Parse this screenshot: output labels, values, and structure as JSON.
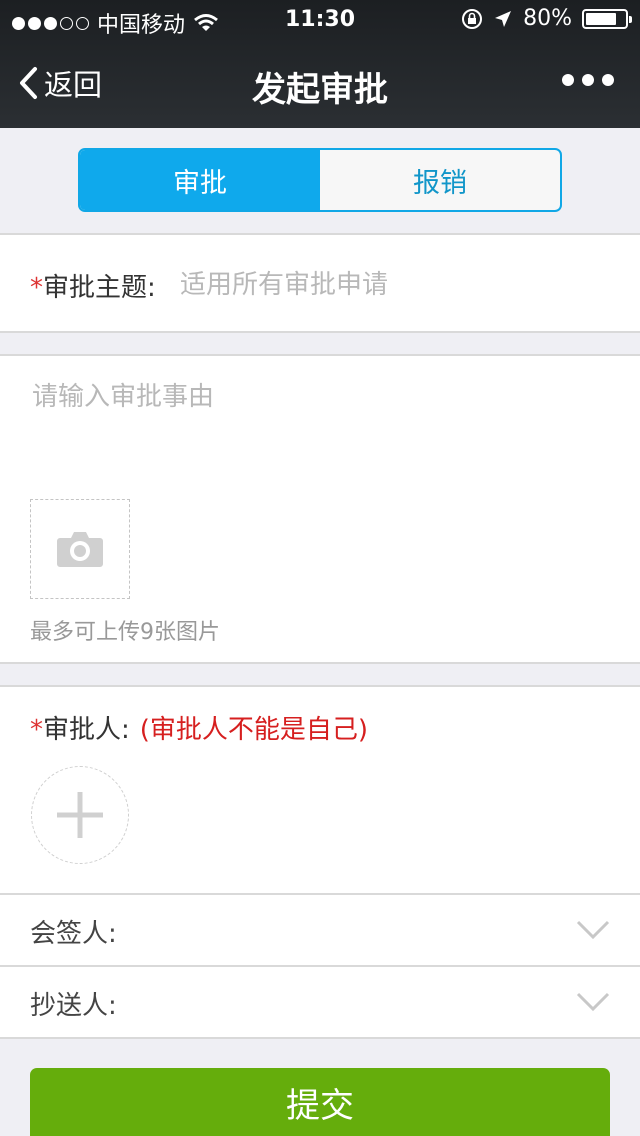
{
  "status_bar": {
    "signal_strength": 3,
    "carrier": "中国移动",
    "time": "11:30",
    "battery": "80%",
    "battery_level": 0.8
  },
  "nav": {
    "back_label": "返回",
    "title": "发起审批"
  },
  "tabs": [
    {
      "label": "审批",
      "active": true
    },
    {
      "label": "报销",
      "active": false
    }
  ],
  "form": {
    "subject": {
      "required_mark": "*",
      "label": "审批主题:",
      "placeholder": "适用所有审批申请",
      "value": ""
    },
    "reason": {
      "placeholder": "请输入审批事由",
      "value": ""
    },
    "upload_hint": "最多可上传9张图片",
    "approver": {
      "required_mark": "*",
      "label": "审批人:",
      "warning": "(审批人不能是自己)"
    },
    "cosigner_label": "会签人:",
    "cc_label": "抄送人:"
  },
  "submit_label": "提交",
  "colors": {
    "accent_blue": "#0fa9ec",
    "submit_green": "#65ad0c",
    "warning_red": "#d61f1f"
  },
  "icons": [
    "back-chevron-icon",
    "more-icon",
    "wifi-icon",
    "location-arrow-icon",
    "rotation-lock-icon",
    "camera-icon",
    "plus-icon",
    "chevron-down-icon"
  ]
}
